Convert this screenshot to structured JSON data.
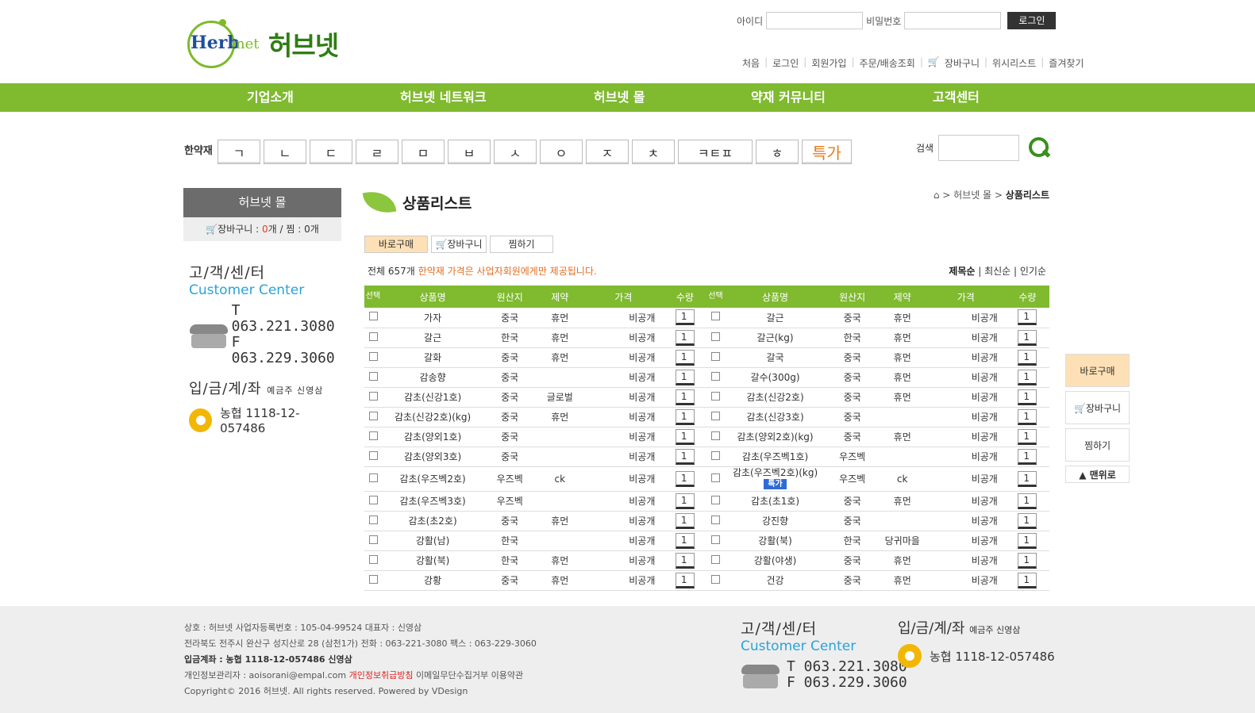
{
  "header": {
    "logo_en1": "Herb",
    "logo_en2": "net",
    "logo_kr": "허브넷",
    "id_label": "아이디",
    "pw_label": "비밀번호",
    "login_btn": "로그인",
    "links": [
      "처음",
      "로그인",
      "회원가입",
      "주문/배송조회",
      "장바구니",
      "위시리스트",
      "즐겨찾기"
    ]
  },
  "nav": [
    "기업소개",
    "허브넷 네트워크",
    "허브넷 몰",
    "약재 커뮤니티",
    "고객센터"
  ],
  "alpha": {
    "label": "한약재",
    "keys": [
      "ㄱ",
      "ㄴ",
      "ㄷ",
      "ㄹ",
      "ㅁ",
      "ㅂ",
      "ㅅ",
      "ㅇ",
      "ㅈ",
      "ㅊ",
      "ㅋㅌㅍ",
      "ㅎ"
    ],
    "special": "특가"
  },
  "search": {
    "label": "검색"
  },
  "side": {
    "mall_title": "허브넷 몰",
    "cart_label": "장바구니",
    "cart_count": "0",
    "cart_unit": "개 / 찜 :",
    "wish_count": "0",
    "wish_unit": "개",
    "cc_kr": "고/객/센/터",
    "cc_en": "Customer Center",
    "tel": "T 063.221.3080",
    "fax": "F 063.229.3060",
    "bank_kr": "입/금/계/좌",
    "bank_owner": "예금주 신영삼",
    "bank_no": "농협 1118-12-057486"
  },
  "main": {
    "title": "상품리스트",
    "crumb_mid": "허브넷 몰",
    "crumb_last": "상품리스트",
    "buy_btn": "바로구매",
    "cart_btn": "장바구니",
    "wish_btn": "찜하기",
    "total": "전체 657개",
    "notice_hl": "한약재 가격은 사업자회원에게만 제공됩니다.",
    "sort": [
      "제목순",
      "최신순",
      "인기순"
    ],
    "headers": [
      "선택",
      "상품명",
      "원산지",
      "제약",
      "가격",
      "수량"
    ],
    "left": [
      [
        "가자",
        "중국",
        "휴먼",
        "비공개",
        "1"
      ],
      [
        "갈근",
        "한국",
        "휴먼",
        "비공개",
        "1"
      ],
      [
        "갈화",
        "중국",
        "휴먼",
        "비공개",
        "1"
      ],
      [
        "감송향",
        "중국",
        "",
        "비공개",
        "1"
      ],
      [
        "감초(신강1호)",
        "중국",
        "글로벌",
        "비공개",
        "1"
      ],
      [
        "감초(신강2호)(kg)",
        "중국",
        "휴먼",
        "비공개",
        "1"
      ],
      [
        "감초(양외1호)",
        "중국",
        "",
        "비공개",
        "1"
      ],
      [
        "감초(양외3호)",
        "중국",
        "",
        "비공개",
        "1"
      ],
      [
        "감초(우즈벡2호)",
        "우즈벡",
        "ck",
        "비공개",
        "1"
      ],
      [
        "감초(우즈벡3호)",
        "우즈벡",
        "",
        "비공개",
        "1"
      ],
      [
        "감초(초2호)",
        "중국",
        "휴먼",
        "비공개",
        "1"
      ],
      [
        "강활(남)",
        "한국",
        "",
        "비공개",
        "1"
      ],
      [
        "강활(북)",
        "한국",
        "휴먼",
        "비공개",
        "1"
      ],
      [
        "강황",
        "중국",
        "휴먼",
        "비공개",
        "1"
      ]
    ],
    "right": [
      [
        "갈근",
        "중국",
        "휴먼",
        "비공개",
        "1"
      ],
      [
        "갈근(kg)",
        "한국",
        "휴먼",
        "비공개",
        "1"
      ],
      [
        "갈국",
        "중국",
        "휴먼",
        "비공개",
        "1"
      ],
      [
        "갈수(300g)",
        "중국",
        "휴먼",
        "비공개",
        "1"
      ],
      [
        "감초(신강2호)",
        "중국",
        "휴먼",
        "비공개",
        "1"
      ],
      [
        "감초(신강3호)",
        "중국",
        "",
        "비공개",
        "1"
      ],
      [
        "감초(양외2호)(kg)",
        "중국",
        "휴먼",
        "비공개",
        "1"
      ],
      [
        "감초(우즈벡1호)",
        "우즈벡",
        "",
        "비공개",
        "1"
      ],
      [
        "감초(우즈벡2호)(kg)",
        "우즈벡",
        "ck",
        "비공개",
        "1"
      ],
      [
        "감초(초1호)",
        "중국",
        "휴먼",
        "비공개",
        "1"
      ],
      [
        "강진향",
        "중국",
        "",
        "비공개",
        "1"
      ],
      [
        "강활(북)",
        "한국",
        "당귀마을",
        "비공개",
        "1"
      ],
      [
        "강활(야생)",
        "중국",
        "휴먼",
        "비공개",
        "1"
      ],
      [
        "건강",
        "중국",
        "휴먼",
        "비공개",
        "1"
      ]
    ],
    "special_tag": "특가"
  },
  "quick": {
    "buy": "바로구매",
    "cart": "장바구니",
    "wish": "찜하기",
    "top": "▲ 맨위로"
  },
  "footer": {
    "l1": "상호 : 허브넷 사업자등록번호 : 105-04-99524 대표자 : 신영삼",
    "l2": "전라북도 전주시 완산구 성지산로 28 (삼천1가) 전화 : 063-221-3080 팩스 : 063-229-3060",
    "l3": "입금계좌 : 농협 1118-12-057486 신영삼",
    "l4a": "개인정보관리자 : aoisorani@empal.com",
    "l4b": "개인정보취급방침",
    "l4c": "이메일무단수집거부 이용약관",
    "l5": "Copyright© 2016 허브넷. All rights reserved. Powered by VDesign"
  }
}
